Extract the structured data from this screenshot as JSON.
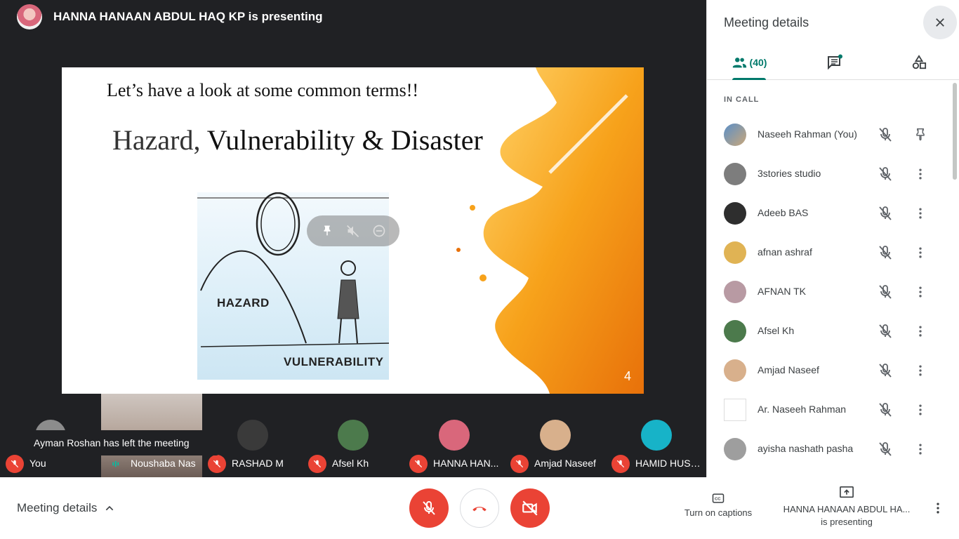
{
  "presenter_bar": {
    "title": "HANNA HANAAN ABDUL HAQ KP is presenting",
    "avatar_icon": "user-avatar"
  },
  "slide": {
    "heading": "Let’s have a look at some common terms!!",
    "title_part1": "Hazard,",
    "title_part2": " Vulnerability  & Disaster",
    "hazard_label": "HAZARD",
    "vulnerability_label": "VULNERABILITY",
    "page_number": "4"
  },
  "tile_overlay": {
    "pin_icon": "pin-icon",
    "mute_icon": "volume-off-icon",
    "remove_icon": "remove-circle-icon"
  },
  "filmstrip": {
    "toast": "Ayman Roshan has left the meeting",
    "tiles": [
      {
        "name": "You",
        "avatar_color": "#8c8c8c"
      },
      {
        "name": "Noushaba Nas",
        "avatar_color": "#6b5c55"
      },
      {
        "name": "RASHAD M",
        "avatar_color": "#3a3a3a"
      },
      {
        "name": "Afsel Kh",
        "avatar_color": "#4c7a4c"
      },
      {
        "name": "HANNA HAN...",
        "avatar_color": "#d9677b"
      },
      {
        "name": "Amjad Naseef",
        "avatar_color": "#d8b08c"
      },
      {
        "name": "HAMID HUSS...",
        "avatar_color": "#17b3c8"
      }
    ]
  },
  "bottom_bar": {
    "meeting_details": "Meeting details",
    "captions": "Turn on captions",
    "presenting_name": "HANNA HANAAN ABDUL HA...",
    "presenting_suffix": "is presenting",
    "accent_red": "#ea4335"
  },
  "side_panel": {
    "title": "Meeting details",
    "people_count": "(40)",
    "in_call_label": "IN CALL",
    "accent": "#00796b",
    "participants": [
      {
        "name": "Naseeh Rahman (You)",
        "action": "pin",
        "avatar_color": "#5b8fc7"
      },
      {
        "name": "3stories studio",
        "action": "more",
        "avatar_color": "#7d7d7d"
      },
      {
        "name": "Adeeb BAS",
        "action": "more",
        "avatar_color": "#2e2e2e"
      },
      {
        "name": "afnan ashraf",
        "action": "more",
        "avatar_color": "#e0b354"
      },
      {
        "name": "AFNAN TK",
        "action": "more",
        "avatar_color": "#b89aa3"
      },
      {
        "name": "Afsel Kh",
        "action": "more",
        "avatar_color": "#4c7a4c"
      },
      {
        "name": "Amjad Naseef",
        "action": "more",
        "avatar_color": "#d8b08c"
      },
      {
        "name": "Ar. Naseeh Rahman",
        "action": "more",
        "avatar_color": "#ffffff"
      },
      {
        "name": "ayisha nashath pasha",
        "action": "more",
        "avatar_color": "#9e9e9e"
      }
    ]
  }
}
